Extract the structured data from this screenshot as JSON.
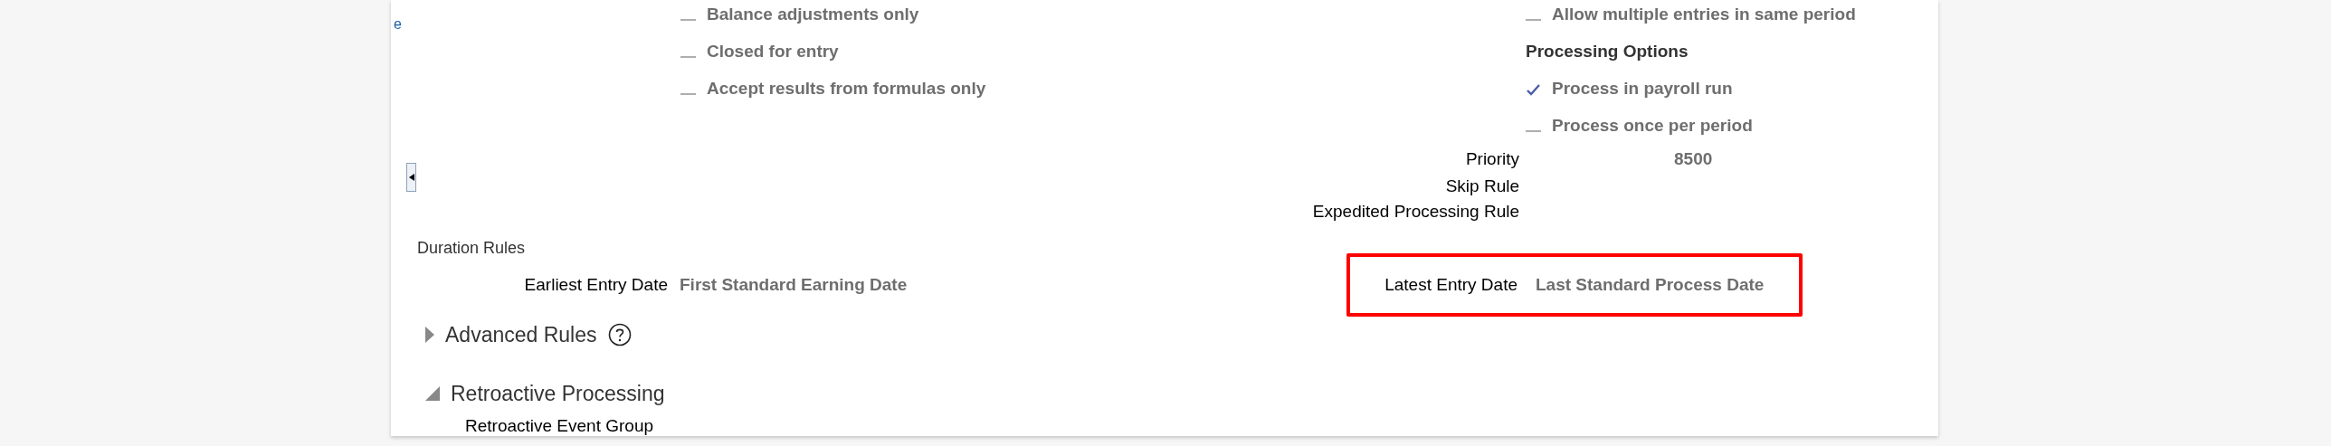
{
  "partial_link": "e",
  "left_options": [
    {
      "label": "Balance adjustments only",
      "checked": false
    },
    {
      "label": "Closed for entry",
      "checked": false
    },
    {
      "label": "Accept results from formulas only",
      "checked": false
    }
  ],
  "right_options": [
    {
      "label": "Allow multiple entries in same period",
      "checked": false
    }
  ],
  "processing_options": {
    "title": "Processing Options",
    "items": [
      {
        "label": "Process in payroll run",
        "checked": true
      },
      {
        "label": "Process once per period",
        "checked": false
      }
    ]
  },
  "properties": [
    {
      "label": "Priority",
      "value": "8500"
    },
    {
      "label": "Skip Rule"
    },
    {
      "label": "Expedited Processing Rule"
    }
  ],
  "duration_rules": {
    "title": "Duration Rules",
    "fields": [
      {
        "label": "Earliest Entry Date",
        "value": "First Standard Earning Date",
        "highlighted": false
      },
      {
        "label": "Latest Entry Date",
        "value": "Last Standard Process Date",
        "highlighted": true
      }
    ]
  },
  "sections": [
    {
      "title": "Advanced Rules",
      "expanded": false,
      "help": true
    },
    {
      "title": "Retroactive Processing",
      "expanded": true,
      "help": false,
      "fields": [
        {
          "label": "Retroactive Event Group"
        }
      ]
    }
  ]
}
